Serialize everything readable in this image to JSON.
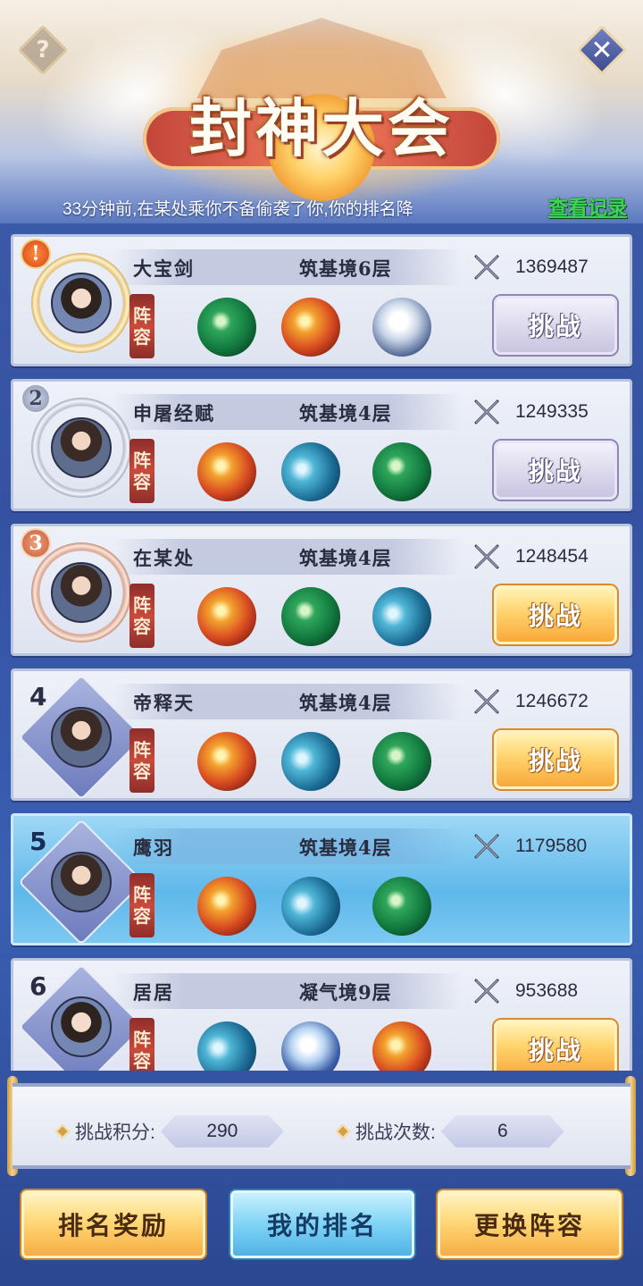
{
  "header": {
    "title": "封神大会",
    "help_icon": "?",
    "close_icon": "✕"
  },
  "notice": {
    "text": "33分钟前,在某处乘你不备偷袭了你,你的排名降",
    "record_link": "查看记录"
  },
  "lineup_label": [
    "阵",
    "容"
  ],
  "players": [
    {
      "rank": "1",
      "badge": "!",
      "name": "大宝剑",
      "realm": "筑基境6层",
      "power": "1369487",
      "pets": [
        "green-dragon",
        "red-dragon",
        "white-tiger"
      ],
      "button": "挑战",
      "button_style": "gray"
    },
    {
      "rank": "2",
      "badge": "2",
      "name": "申屠经赋",
      "realm": "筑基境4层",
      "power": "1249335",
      "pets": [
        "red-dragon",
        "whale",
        "green-dragon"
      ],
      "button": "挑战",
      "button_style": "gray"
    },
    {
      "rank": "3",
      "badge": "3",
      "name": "在某处",
      "realm": "筑基境4层",
      "power": "1248454",
      "pets": [
        "red-dragon",
        "green-dragon",
        "whale"
      ],
      "button": "挑战",
      "button_style": "gold"
    },
    {
      "rank": "4",
      "badge": "4",
      "name": "帝释天",
      "realm": "筑基境4层",
      "power": "1246672",
      "pets": [
        "red-dragon",
        "whale",
        "green-dragon"
      ],
      "button": "挑战",
      "button_style": "gold"
    },
    {
      "rank": "5",
      "badge": "5",
      "name": "鹰羽",
      "realm": "筑基境4层",
      "power": "1179580",
      "pets": [
        "red-dragon",
        "whale",
        "green-dragon"
      ],
      "button": "",
      "button_style": "none"
    },
    {
      "rank": "6",
      "badge": "6",
      "name": "居居",
      "realm": "凝气境9层",
      "power": "953688",
      "pets": [
        "whale",
        "ice-dragon",
        "red-dragon"
      ],
      "button": "挑战",
      "button_style": "gold"
    }
  ],
  "stats": {
    "score_label": "挑战积分:",
    "score_value": "290",
    "count_label": "挑战次数:",
    "count_value": "6"
  },
  "bottom_buttons": {
    "rewards": "排名奖励",
    "my_rank": "我的排名",
    "change_lineup": "更换阵容"
  }
}
